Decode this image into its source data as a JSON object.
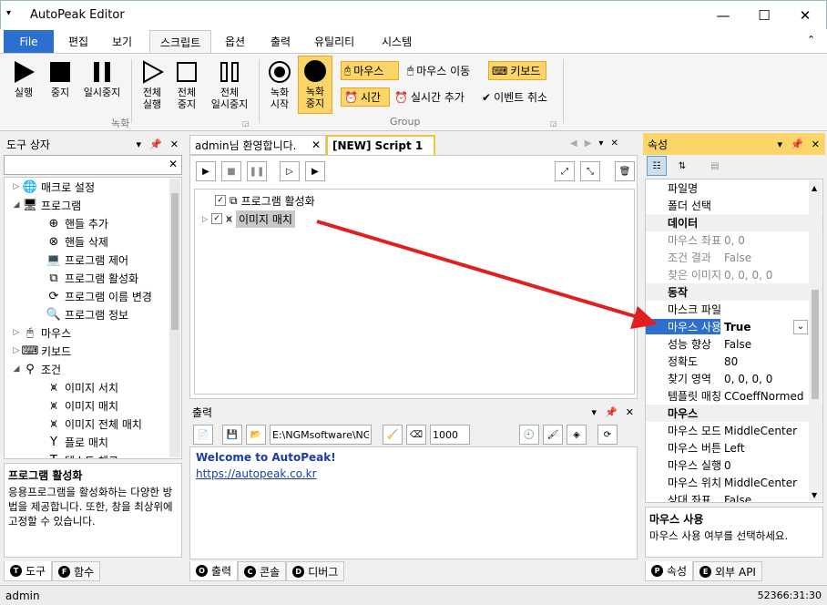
{
  "app": {
    "title": "AutoPeak Editor",
    "quick_access": "▾",
    "win_min": "—",
    "win_max": "☐",
    "win_close": "✕"
  },
  "menu": {
    "tabs": [
      "File",
      "편집",
      "보기",
      "스크립트",
      "옵션",
      "출력",
      "유틸리티",
      "시스템"
    ],
    "active": "스크립트",
    "collapse": "⌃"
  },
  "ribbon": {
    "run": "실행",
    "stop": "중지",
    "pause": "일시중지",
    "run_all": [
      "전체",
      "실행"
    ],
    "stop_all": [
      "전체",
      "중지"
    ],
    "pause_all": [
      "전체",
      "일시중지"
    ],
    "rec_start": [
      "녹화",
      "시작"
    ],
    "rec_stop": [
      "녹화",
      "중지"
    ],
    "mouse": "마우스",
    "mouse_move": "마우스 이동",
    "keyboard": "키보드",
    "time": "시간",
    "realtime_add": "실시간 추가",
    "event_cancel": "이벤트 취소",
    "group_record": "녹화",
    "group_group": "Group"
  },
  "toolbox": {
    "title": "도구 상자",
    "search_placeholder": "",
    "clear": "✕",
    "items": [
      {
        "label": "매크로 설정",
        "arrow": "▷",
        "level": 0
      },
      {
        "label": "프로그램",
        "arrow": "◢",
        "level": 0
      },
      {
        "label": "핸들 추가",
        "arrow": "",
        "level": 1
      },
      {
        "label": "핸들 삭제",
        "arrow": "",
        "level": 1
      },
      {
        "label": "프로그램 제어",
        "arrow": "",
        "level": 1
      },
      {
        "label": "프로그램 활성화",
        "arrow": "",
        "level": 1
      },
      {
        "label": "프로그램 이름 변경",
        "arrow": "",
        "level": 1
      },
      {
        "label": "프로그램 정보",
        "arrow": "",
        "level": 1
      },
      {
        "label": "마우스",
        "arrow": "▷",
        "level": 0
      },
      {
        "label": "키보드",
        "arrow": "▷",
        "level": 0
      },
      {
        "label": "조건",
        "arrow": "◢",
        "level": 0
      },
      {
        "label": "이미지 서치",
        "arrow": "",
        "level": 1
      },
      {
        "label": "이미지 매치",
        "arrow": "",
        "level": 1
      },
      {
        "label": "이미지 전체 매치",
        "arrow": "",
        "level": 1
      },
      {
        "label": "플로 매치",
        "arrow": "",
        "level": 1
      },
      {
        "label": "텍스트 체크",
        "arrow": "",
        "level": 1
      }
    ],
    "desc_title": "프로그램 활성화",
    "desc_text": "응용프로그램을 활성화하는 다양한 방법을 제공합니다. 또한, 창을 최상위에 고정할 수 있습니다.",
    "tabs": [
      {
        "key": "T",
        "label": "도구"
      },
      {
        "key": "F",
        "label": "함수"
      }
    ]
  },
  "editor": {
    "tabs": [
      "admin님 환영합니다.",
      "[NEW] Script 1"
    ],
    "tree": [
      {
        "label": "프로그램 활성화"
      },
      {
        "label": "이미지 매치"
      }
    ]
  },
  "output": {
    "title": "출력",
    "path": "E:\\NGMsoftware\\NG",
    "number": "1000",
    "welcome": "Welcome to AutoPeak!",
    "link": "https://autopeak.co.kr",
    "tabs": [
      {
        "key": "O",
        "label": "출력"
      },
      {
        "key": "C",
        "label": "콘솔"
      },
      {
        "key": "D",
        "label": "디버그"
      }
    ]
  },
  "properties": {
    "title": "속성",
    "rows": [
      {
        "k": "파일명",
        "v": "",
        "type": "item"
      },
      {
        "k": "폴더 선택",
        "v": "",
        "type": "item"
      },
      {
        "k": "데이터",
        "v": "",
        "type": "cat"
      },
      {
        "k": "마우스 좌표",
        "v": "0, 0",
        "type": "gray"
      },
      {
        "k": "조건 결과",
        "v": "False",
        "type": "gray"
      },
      {
        "k": "찾은 이미지",
        "v": "0, 0, 0, 0",
        "type": "gray"
      },
      {
        "k": "동작",
        "v": "",
        "type": "cat"
      },
      {
        "k": "마스크 파일",
        "v": "",
        "type": "item"
      },
      {
        "k": "마우스 사용",
        "v": "True",
        "type": "sel"
      },
      {
        "k": "성능 향상",
        "v": "False",
        "type": "item"
      },
      {
        "k": "정확도",
        "v": "80",
        "type": "item"
      },
      {
        "k": "찾기 영역",
        "v": "0, 0, 0, 0",
        "type": "item"
      },
      {
        "k": "템플릿 매칭",
        "v": "CCoeffNormed",
        "type": "item"
      },
      {
        "k": "마우스",
        "v": "",
        "type": "cat"
      },
      {
        "k": "마우스 모드",
        "v": "MiddleCenter",
        "type": "item"
      },
      {
        "k": "마우스 버튼",
        "v": "Left",
        "type": "item"
      },
      {
        "k": "마우스 실행",
        "v": "0",
        "type": "item"
      },
      {
        "k": "마우스 위치",
        "v": "MiddleCenter",
        "type": "item"
      },
      {
        "k": "상대 좌표",
        "v": "False",
        "type": "item"
      }
    ],
    "desc_title": "마우스 사용",
    "desc_text": "마우스 사용 여부를 선택하세요.",
    "tabs": [
      {
        "key": "P",
        "label": "속성"
      },
      {
        "key": "E",
        "label": "외부 API"
      }
    ]
  },
  "status": {
    "user": "admin",
    "time": "52366:31:30"
  },
  "colors": {
    "accent": "#2b6fcf",
    "highlight": "#fcd56a",
    "arrow": "#e02020",
    "link": "#1a3ca8"
  }
}
